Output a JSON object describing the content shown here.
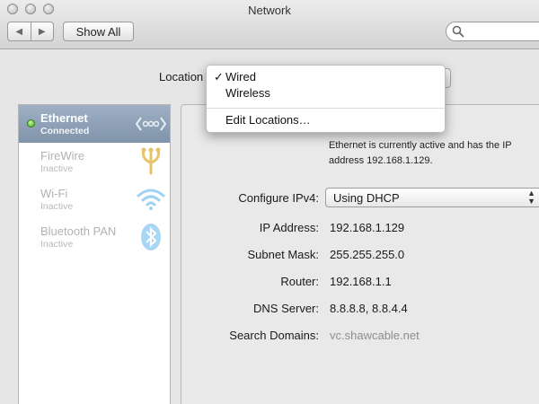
{
  "window": {
    "title": "Network"
  },
  "toolbar": {
    "back_label": "◀",
    "forward_label": "▶",
    "show_all_label": "Show All",
    "search_placeholder": ""
  },
  "location": {
    "label": "Location",
    "menu": [
      {
        "label": "Wired",
        "checked": true,
        "check": "✓"
      },
      {
        "label": "Wireless",
        "checked": false,
        "check": ""
      },
      {
        "label": "Edit Locations…",
        "checked": false,
        "check": ""
      }
    ]
  },
  "services": [
    {
      "name": "Ethernet",
      "status": "Connected",
      "selected": true,
      "icon": "ethernet-icon"
    },
    {
      "name": "FireWire",
      "status": "Inactive",
      "selected": false,
      "icon": "firewire-icon"
    },
    {
      "name": "Wi-Fi",
      "status": "Inactive",
      "selected": false,
      "icon": "wifi-icon"
    },
    {
      "name": "Bluetooth PAN",
      "status": "Inactive",
      "selected": false,
      "icon": "bluetooth-icon"
    }
  ],
  "detail": {
    "status_message": "Ethernet is currently active and has the IP address 192.168.1.129.",
    "configure_ipv4": {
      "label": "Configure IPv4:",
      "value": "Using DHCP"
    },
    "ip_address": {
      "label": "IP Address:",
      "value": "192.168.1.129"
    },
    "subnet_mask": {
      "label": "Subnet Mask:",
      "value": "255.255.255.0"
    },
    "router": {
      "label": "Router:",
      "value": "192.168.1.1"
    },
    "dns_server": {
      "label": "DNS Server:",
      "value": "8.8.8.8, 8.8.4.4"
    },
    "search_domains": {
      "label": "Search Domains:",
      "value": "vc.shawcable.net"
    }
  },
  "colors": {
    "status_green": "#3cae1a",
    "selection_blue": "#8c9eb4",
    "icon_blue": "#5fb3e6",
    "icon_gold": "#e7c46a"
  }
}
